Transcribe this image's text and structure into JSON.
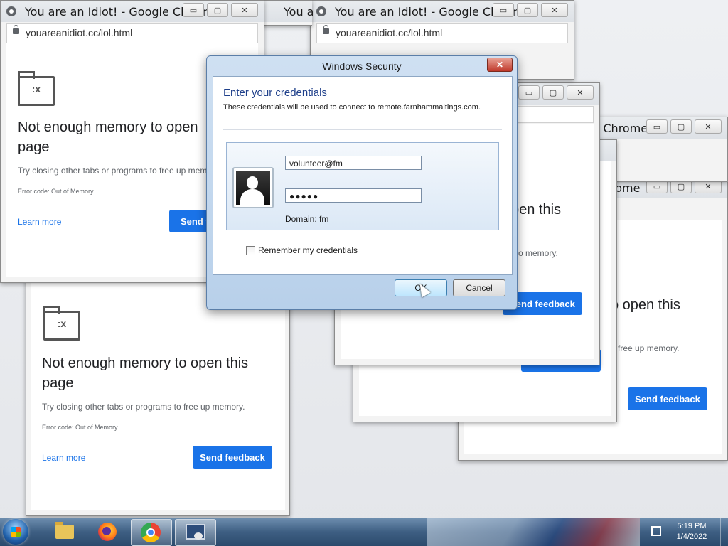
{
  "chrome_window": {
    "title": "You are an Idiot! - Google Chrome",
    "title_truncated": "You a",
    "title_suffix1": "le Chrome",
    "title_suffix2": "rome",
    "url": "youareanidiot.cc/lol.html",
    "controls": {
      "minimize": "▭",
      "maximize": "▢",
      "close": "✕"
    }
  },
  "error_page": {
    "title": "Not enough memory to open this page",
    "title_partial": "Not enough memory to open\npage",
    "title_frag_a": "pen this",
    "title_frag_b": "o open this",
    "subtitle": "Try closing other tabs or programs to free up memory.",
    "subtitle_partial": "Try closing other tabs or programs to free up mem",
    "subtitle_frag_a": "o memory.",
    "subtitle_frag_b": "free up memory.",
    "error_code": "Error code: Out of Memory",
    "learn_more": "Learn more",
    "send_feedback": "Send feedback",
    "send_feedback_partial": "Send f",
    "sad_face": ":x"
  },
  "dialog": {
    "title": "Windows Security",
    "close": "✕",
    "heading": "Enter your credentials",
    "description": "These credentials will be used to connect to remote.farnhammaltings.com.",
    "username": "volunteer@fm",
    "password_mask": "●●●●●",
    "domain": "Domain: fm",
    "remember_label": "Remember my credentials",
    "remember_checked": false,
    "ok_label": "OK",
    "cancel_label": "Cancel"
  },
  "taskbar": {
    "time": "5:19 PM",
    "date": "1/4/2022",
    "items": [
      "start-orb",
      "folder-icon",
      "firefox-icon",
      "chrome-icon",
      "remote-desktop-icon"
    ],
    "active_item": "chrome-icon"
  }
}
